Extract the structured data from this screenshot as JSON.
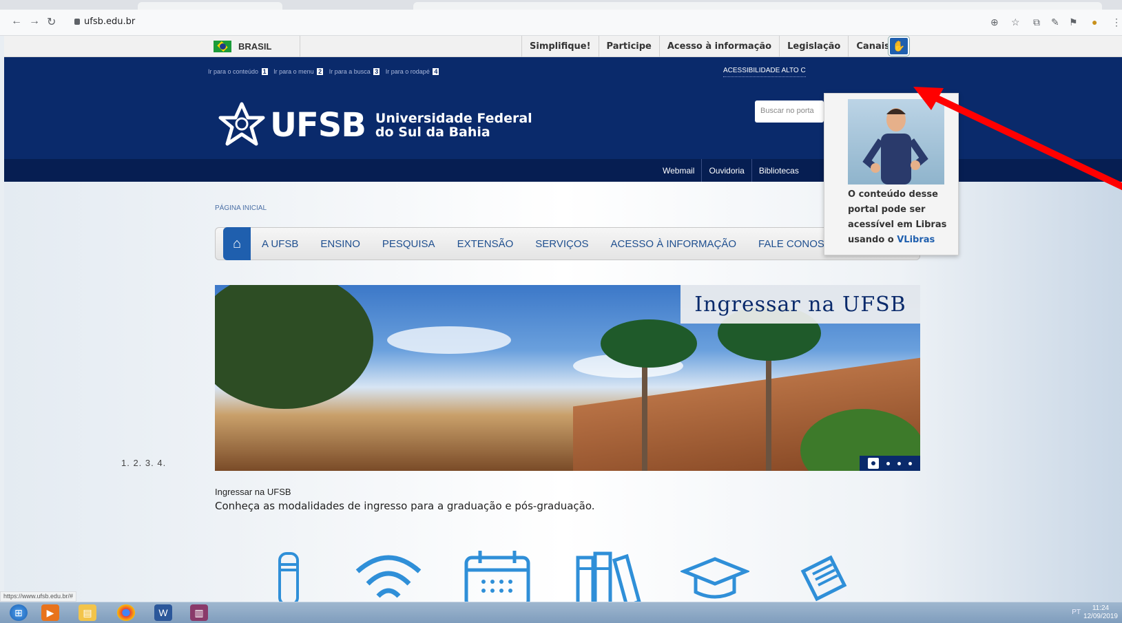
{
  "browser": {
    "url": "ufsb.edu.br",
    "status_url": "https://www.ufsb.edu.br/#"
  },
  "govbar": {
    "brasil": "BRASIL",
    "links": [
      "Simplifique!",
      "Participe",
      "Acesso à informação",
      "Legislação",
      "Canais"
    ]
  },
  "header": {
    "skip_links": [
      {
        "label": "Ir para o conteúdo",
        "num": "1"
      },
      {
        "label": "Ir para o menu",
        "num": "2"
      },
      {
        "label": "Ir para a busca",
        "num": "3"
      },
      {
        "label": "Ir para o rodapé",
        "num": "4"
      }
    ],
    "accessibility": "ACESSIBILIDADE   ALTO C",
    "search_placeholder": "Buscar no porta",
    "logo_acronym": "UFSB",
    "logo_name_line1": "Universidade Federal",
    "logo_name_line2": "do Sul da Bahia"
  },
  "subbar": {
    "items": [
      "Webmail",
      "Ouvidoria",
      "Bibliotecas"
    ]
  },
  "breadcrumb": "PÁGINA INICIAL",
  "mainnav": {
    "items": [
      "A UFSB",
      "ENSINO",
      "PESQUISA",
      "EXTENSÃO",
      "SERVIÇOS",
      "ACESSO À INFORMAÇÃO",
      "FALE CONOSCO"
    ]
  },
  "banner": {
    "title": "Ingressar na UFSB",
    "pager": "1.  2.  3.  4."
  },
  "caption": {
    "title": "Ingressar na UFSB",
    "text": "Conheça as modalidades de ingresso para a graduação e pós-graduação."
  },
  "vlibras": {
    "line1": "O conteúdo desse",
    "line2": "portal pode ser",
    "line3": "acessível em Libras",
    "line4_prefix": "usando o ",
    "line4_link": "VLibras"
  },
  "taskbar": {
    "tray": "PT",
    "time": "11:24",
    "date": "12/09/2019"
  },
  "colors": {
    "header_blue": "#0a2a6b",
    "accent_blue": "#1f5fae",
    "arrow_red": "#ff0000"
  }
}
